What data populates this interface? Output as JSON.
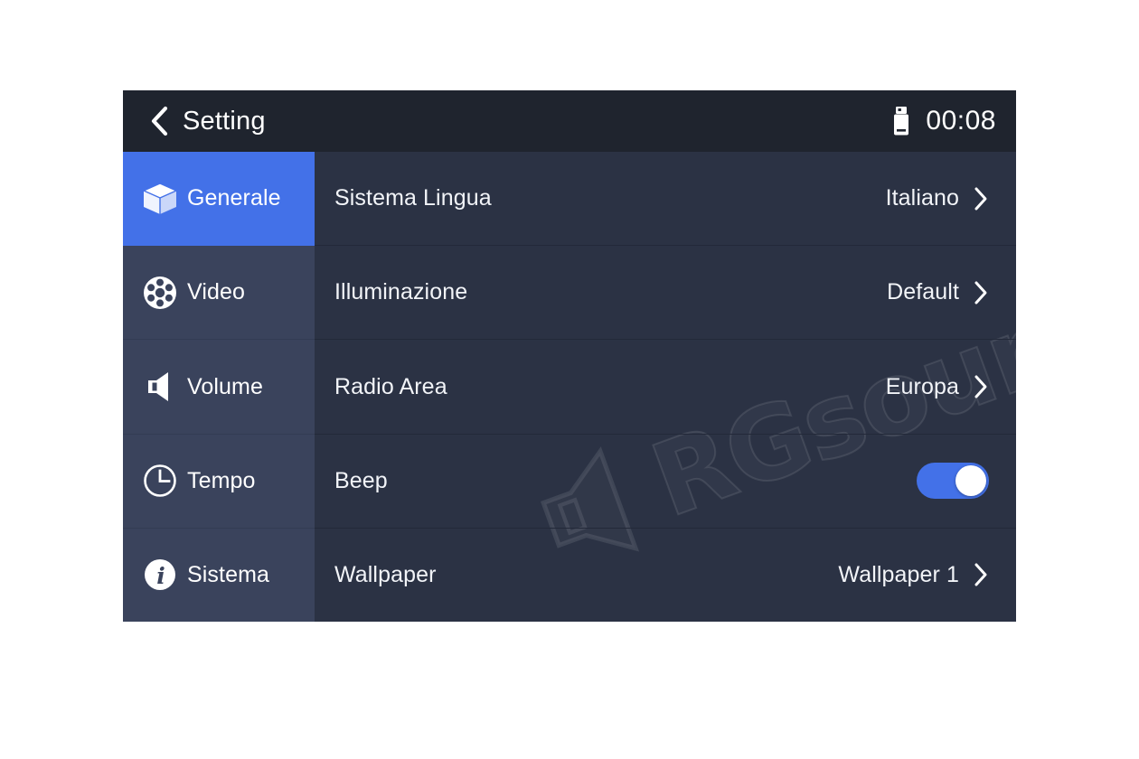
{
  "header": {
    "title": "Setting",
    "back_icon": "chevron-left-icon",
    "usb_icon": "usb-drive-icon",
    "clock": "00:08"
  },
  "sidebar": {
    "items": [
      {
        "label": "Generale",
        "icon": "cube-icon",
        "active": true
      },
      {
        "label": "Video",
        "icon": "film-reel-icon",
        "active": false
      },
      {
        "label": "Volume",
        "icon": "speaker-icon",
        "active": false
      },
      {
        "label": "Tempo",
        "icon": "clock-icon",
        "active": false
      },
      {
        "label": "Sistema",
        "icon": "info-circle-icon",
        "active": false
      }
    ]
  },
  "content": {
    "rows": [
      {
        "label": "Sistema Lingua",
        "value": "Italiano",
        "type": "link"
      },
      {
        "label": "Illuminazione",
        "value": "Default",
        "type": "link"
      },
      {
        "label": "Radio Area",
        "value": "Europa",
        "type": "link"
      },
      {
        "label": "Beep",
        "value": "",
        "type": "toggle",
        "toggle_on": true
      },
      {
        "label": "Wallpaper",
        "value": "Wallpaper 1",
        "type": "link"
      }
    ]
  },
  "watermark": {
    "text": "RGsound",
    "icon": "speaker-outline-icon"
  },
  "colors": {
    "accent_blue": "#4371e8",
    "header_bg": "#1f242e",
    "sidebar_bg": "#3a435c",
    "content_bg": "#2b3244",
    "text": "#f2f4f8"
  }
}
